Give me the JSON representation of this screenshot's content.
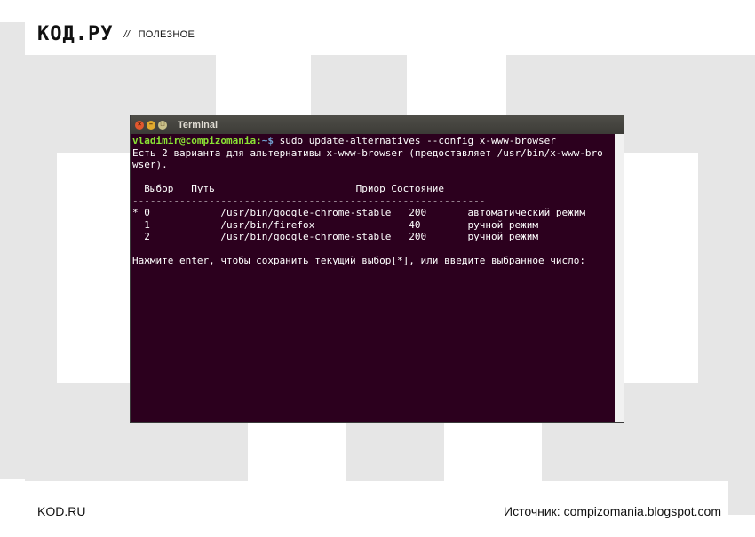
{
  "header": {
    "logo": "КОД.РУ",
    "separator": "//",
    "section": "ПОЛЕЗНОЕ"
  },
  "terminal": {
    "title": "Terminal",
    "prompt_user_host": "vladimir@compizomania:",
    "prompt_path": "~$",
    "command": " sudo update-alternatives --config x-www-browser",
    "lines": [
      "Есть 2 варианта для альтернативы x-www-browser (предоставляет /usr/bin/x-www-bro",
      "wser).",
      "",
      "  Выбор   Путь                        Приор Состояние",
      "------------------------------------------------------------",
      "* 0            /usr/bin/google-chrome-stable   200       автоматический режим",
      "  1            /usr/bin/firefox                40        ручной режим",
      "  2            /usr/bin/google-chrome-stable   200       ручной режим",
      "",
      "Нажмите enter, чтобы сохранить текущий выбор[*], или введите выбранное число:"
    ]
  },
  "footer": {
    "left": "KOD.RU",
    "right": "Источник: compizomania.blogspot.com"
  },
  "colors": {
    "terminal_bg": "#2c001e",
    "prompt_user": "#8ae234",
    "prompt_path": "#729fcf",
    "background_shapes": "#e6e6e6"
  }
}
